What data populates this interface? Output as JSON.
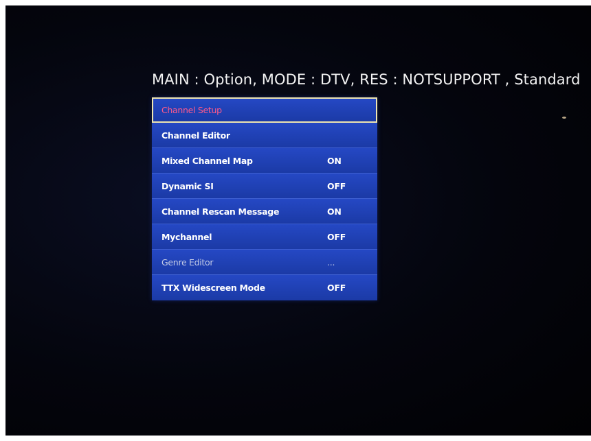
{
  "header": {
    "status_text": "MAIN : Option, MODE : DTV, RES : NOTSUPPORT , Standard"
  },
  "menu": {
    "items": [
      {
        "label": "Channel Setup",
        "value": ""
      },
      {
        "label": "Channel Editor",
        "value": ""
      },
      {
        "label": "Mixed Channel Map",
        "value": "ON"
      },
      {
        "label": "Dynamic SI",
        "value": "OFF"
      },
      {
        "label": "Channel Rescan Message",
        "value": "ON"
      },
      {
        "label": "Mychannel",
        "value": "OFF"
      },
      {
        "label": "Genre Editor",
        "value": "..."
      },
      {
        "label": "TTX Widescreen Mode",
        "value": "OFF"
      }
    ],
    "selected_index": 0,
    "disabled_index": 6
  },
  "colors": {
    "menu_background": "#2548c4",
    "selection_border": "#f0e6b0",
    "selected_text": "#ff5a8a",
    "screen_background": "#04050d"
  }
}
